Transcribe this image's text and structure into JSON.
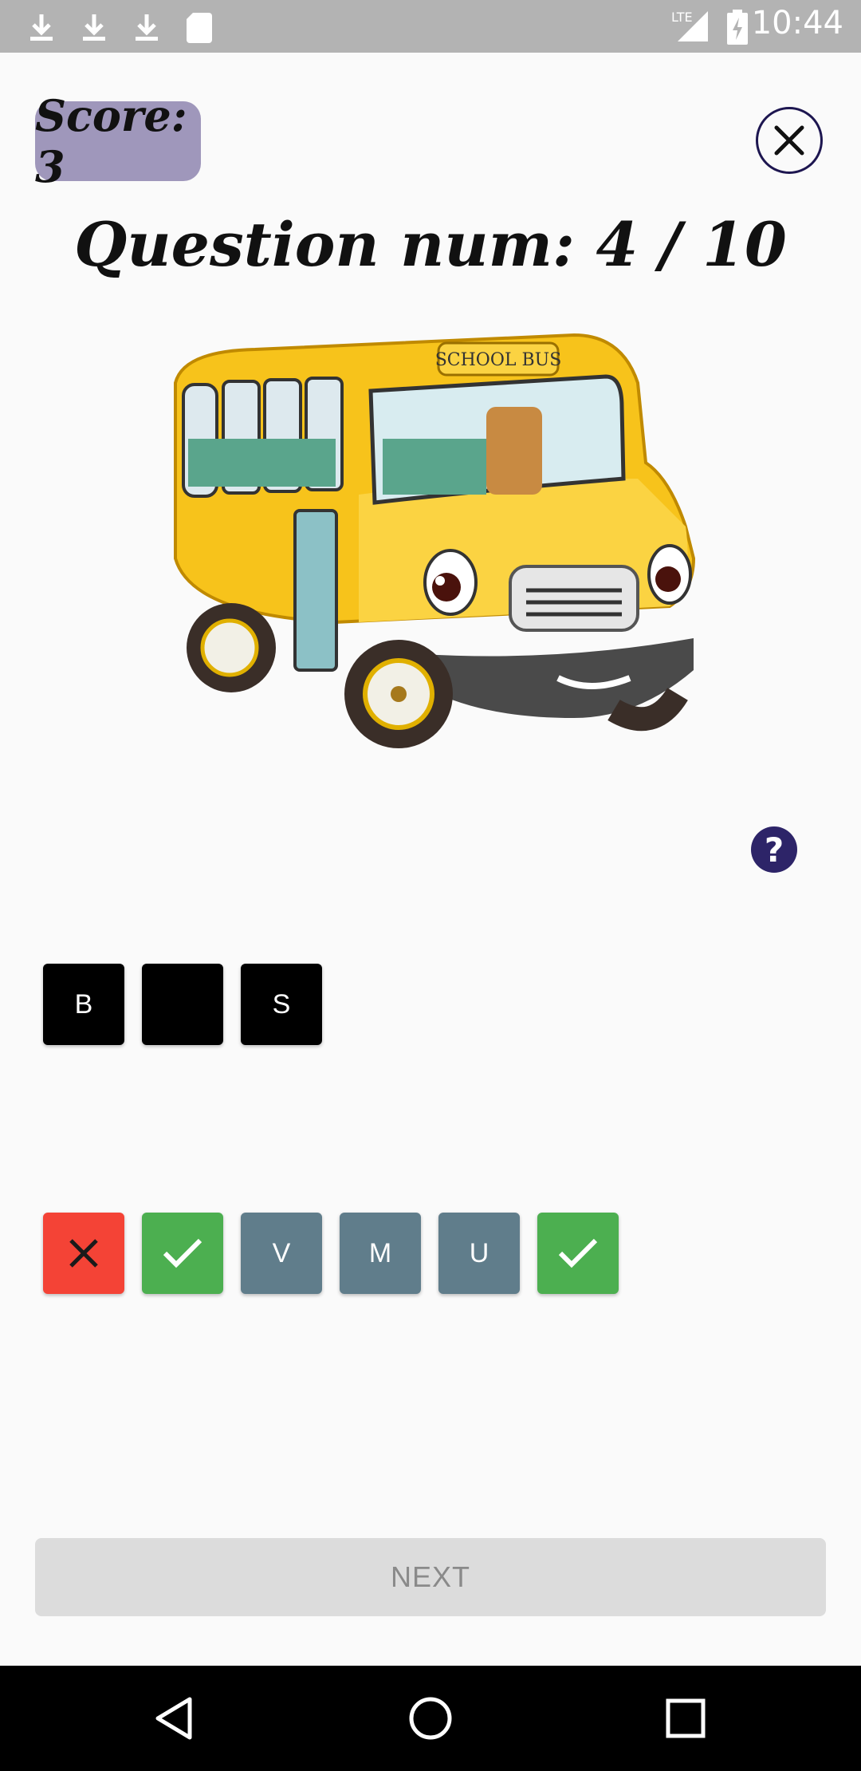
{
  "status_bar": {
    "time": "10:44",
    "network": "LTE",
    "icons": [
      "download-icon",
      "download-icon",
      "download-icon",
      "sd-card-icon",
      "signal-icon",
      "battery-charging-icon"
    ]
  },
  "score": {
    "label": "Score: 3"
  },
  "question": {
    "label": "Question num: 4 / 10"
  },
  "image": {
    "sign_text": "SCHOOL BUS"
  },
  "help": {
    "label": "?"
  },
  "answer_slots": [
    {
      "letter": "B"
    },
    {
      "letter": ""
    },
    {
      "letter": "S"
    }
  ],
  "choices": [
    {
      "letter": "",
      "state": "wrong",
      "icon": "x-icon",
      "color": "#f44336"
    },
    {
      "letter": "",
      "state": "correct",
      "icon": "check-icon",
      "color": "#4caf50"
    },
    {
      "letter": "V",
      "state": "available",
      "color": "#607d8b"
    },
    {
      "letter": "M",
      "state": "available",
      "color": "#607d8b"
    },
    {
      "letter": "U",
      "state": "available",
      "color": "#607d8b"
    },
    {
      "letter": "",
      "state": "correct",
      "icon": "check-icon",
      "color": "#4caf50"
    }
  ],
  "next_button": {
    "label": "NEXT",
    "enabled": false
  },
  "colors": {
    "score_badge": "#9f97bb",
    "accent": "#2d2468",
    "slot": "#000000"
  }
}
